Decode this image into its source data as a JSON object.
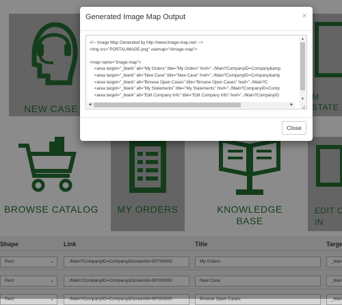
{
  "portal": {
    "tiles": [
      "NEW CASE",
      "MY\nSTATE",
      "BROWSE CATALOG",
      "MY ORDERS",
      "KNOWLEDGE\nBASE",
      "EDIT C\nIN"
    ],
    "brand_color": "#1f5f2c"
  },
  "table": {
    "headers": {
      "shape": "Shape",
      "link": "Link",
      "title": "Title",
      "target": "Target"
    },
    "rows": [
      {
        "shape": "Rect",
        "link": "./Main?CompanyID=Company&ScreenId=SP700003",
        "title": "My Orders",
        "target": "_blan"
      },
      {
        "shape": "Rect",
        "link": "./Main?CompanyID=Company&ScreenId=SP203000",
        "title": "New Case",
        "target": "_blan"
      },
      {
        "shape": "Rect",
        "link": "./Main?CompanyID=Company&ScreenId=SP203000",
        "title": "Browse Open Cases",
        "target": "_blan"
      }
    ]
  },
  "modal": {
    "title": "Generated Image Map Output",
    "close_symbol": "×",
    "code_lines": [
      "<!-- Image Map Generated by http://www.image-map.net/ -->",
      "<img src=\"PORTALIMAGE.png\" usemap=\"#image-map\">",
      "",
      "<map name=\"image-map\">",
      "    <area target=\"_blank\" alt=\"My Orders\" title=\"My Orders\" href=\"../Main?CompanyID=Company&amp",
      "    <area target=\"_blank\" alt=\"New Case\" title=\"New Case\" href=\"../Main?CompanyID=Company&amp",
      "    <area target=\"_blank\" alt=\"Browse Open Cases\" title=\"Browse Open Cases\" href=\"../Main?C",
      "    <area target=\"_blank\" alt=\"My Statements\" title=\"My Statements\" href=\"../Main?CompanyID=Comp",
      "    <area target=\"_blank\" alt=\"Edit Company Info\" title=\"Edit Company Info\" href=\"../Main?CompanyID"
    ],
    "close_button": "Close"
  },
  "scroll_arrows": {
    "up": "▲",
    "down": "▼",
    "left": "◀",
    "right": "▶"
  }
}
